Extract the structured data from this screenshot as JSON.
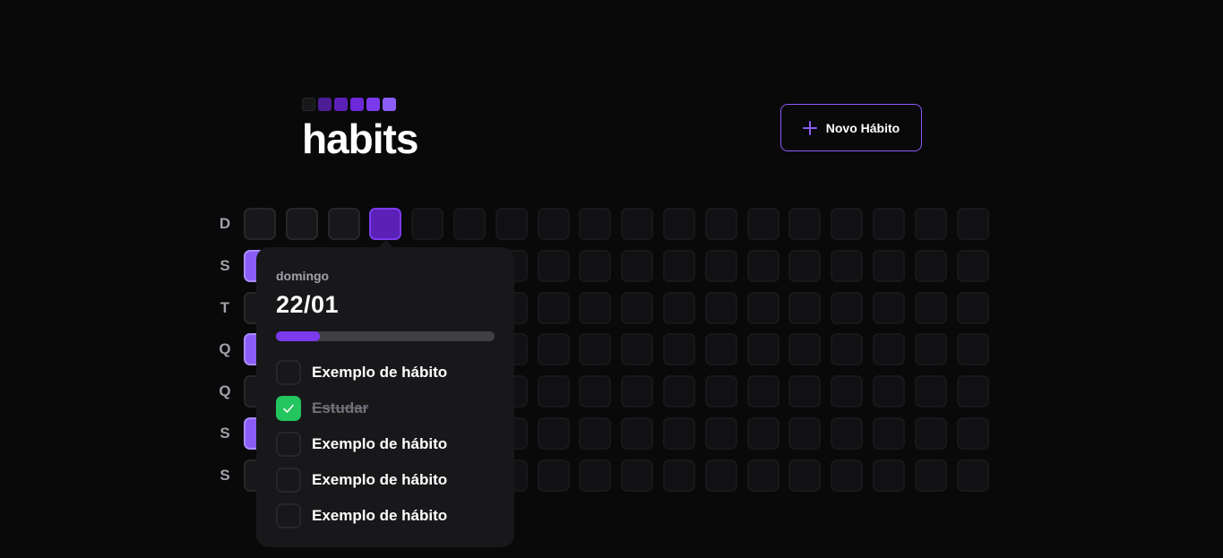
{
  "header": {
    "logo_text": "habits",
    "logo_colors": [
      "#18181b",
      "#4c1d95",
      "#5b21b6",
      "#6d28d9",
      "#7c3aed",
      "#8b5cf6"
    ],
    "new_habit_label": "Novo Hábito"
  },
  "weekdays": [
    "D",
    "S",
    "T",
    "Q",
    "Q",
    "S",
    "S"
  ],
  "grid": {
    "columns": 18,
    "past_first_row": 3,
    "selected": {
      "row": 0,
      "col": 3
    },
    "completed": [
      [
        1,
        0
      ],
      [
        3,
        0
      ],
      [
        5,
        0
      ]
    ]
  },
  "colors": {
    "accent": "#8b5cf6",
    "selected": "#5b21b6",
    "done": "#22c55e",
    "background": "#09090a"
  },
  "popover": {
    "weekday": "domingo",
    "date": "22/01",
    "progress_percent": 20,
    "habits": [
      {
        "label": "Exemplo de hábito",
        "checked": false
      },
      {
        "label": "Estudar",
        "checked": true
      },
      {
        "label": "Exemplo de hábito",
        "checked": false
      },
      {
        "label": "Exemplo de hábito",
        "checked": false
      },
      {
        "label": "Exemplo de hábito",
        "checked": false
      }
    ]
  }
}
